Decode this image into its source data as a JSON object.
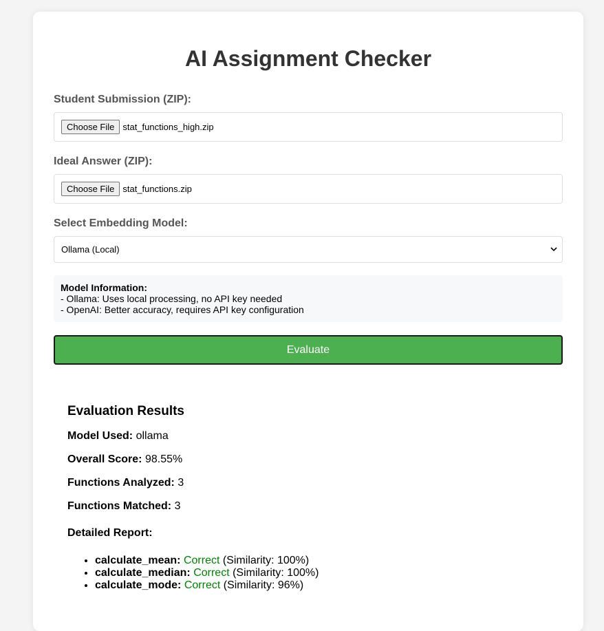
{
  "app": {
    "title": "AI Assignment Checker"
  },
  "form": {
    "student": {
      "label": "Student Submission (ZIP):",
      "button": "Choose File",
      "filename": "stat_functions_high.zip"
    },
    "ideal": {
      "label": "Ideal Answer (ZIP):",
      "button": "Choose File",
      "filename": "stat_functions.zip"
    },
    "model": {
      "label": "Select Embedding Model:",
      "selected": "Ollama (Local)"
    },
    "info": {
      "heading": "Model Information:",
      "lines": [
        "- Ollama: Uses local processing, no API key needed",
        "- OpenAI: Better accuracy, requires API key configuration"
      ]
    },
    "evaluate_label": "Evaluate"
  },
  "results": {
    "heading": "Evaluation Results",
    "model_used": {
      "label": "Model Used:",
      "value": "ollama"
    },
    "overall_score": {
      "label": "Overall Score:",
      "value": "98.55%"
    },
    "functions_analyzed": {
      "label": "Functions Analyzed:",
      "value": "3"
    },
    "functions_matched": {
      "label": "Functions Matched:",
      "value": "3"
    },
    "report_label": "Detailed Report:",
    "report": [
      {
        "name": "calculate_mean:",
        "status": "Correct",
        "similarity": "(Similarity: 100%)"
      },
      {
        "name": "calculate_median:",
        "status": "Correct",
        "similarity": "(Similarity: 100%)"
      },
      {
        "name": "calculate_mode:",
        "status": "Correct",
        "similarity": "(Similarity: 96%)"
      }
    ]
  },
  "colors": {
    "accent": "#4caf50",
    "correct": "#008000"
  },
  "icons": {
    "select_arrow": "chevron-down-icon"
  }
}
